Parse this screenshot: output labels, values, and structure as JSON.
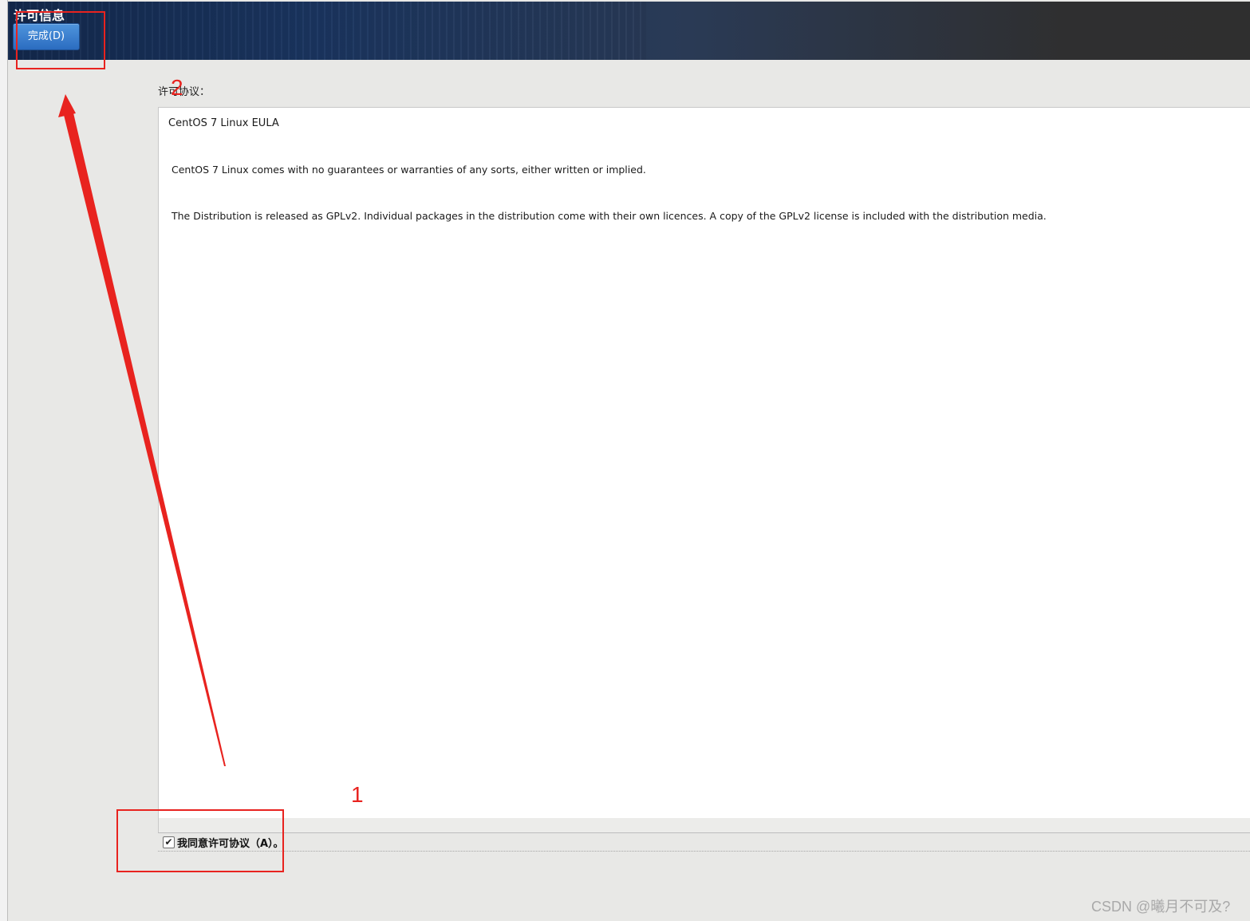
{
  "header": {
    "title": "许可信息",
    "done_button": "完成(D)"
  },
  "license": {
    "label": "许可协议：",
    "title": "CentOS 7 Linux EULA",
    "paragraphs": [
      "CentOS 7 Linux comes with no guarantees or warranties of any sorts, either written or implied.",
      "The Distribution is released as GPLv2. Individual packages in the distribution come with their own licences. A copy of the GPLv2 license is included with the distribution media."
    ]
  },
  "agreement": {
    "label": "我同意许可协议（A）。",
    "checked": true,
    "check_mark": "✔"
  },
  "annotations": {
    "step1": "1",
    "step2": "2",
    "color": "#e8231f"
  },
  "watermark": "CSDN @曦月不可及?"
}
